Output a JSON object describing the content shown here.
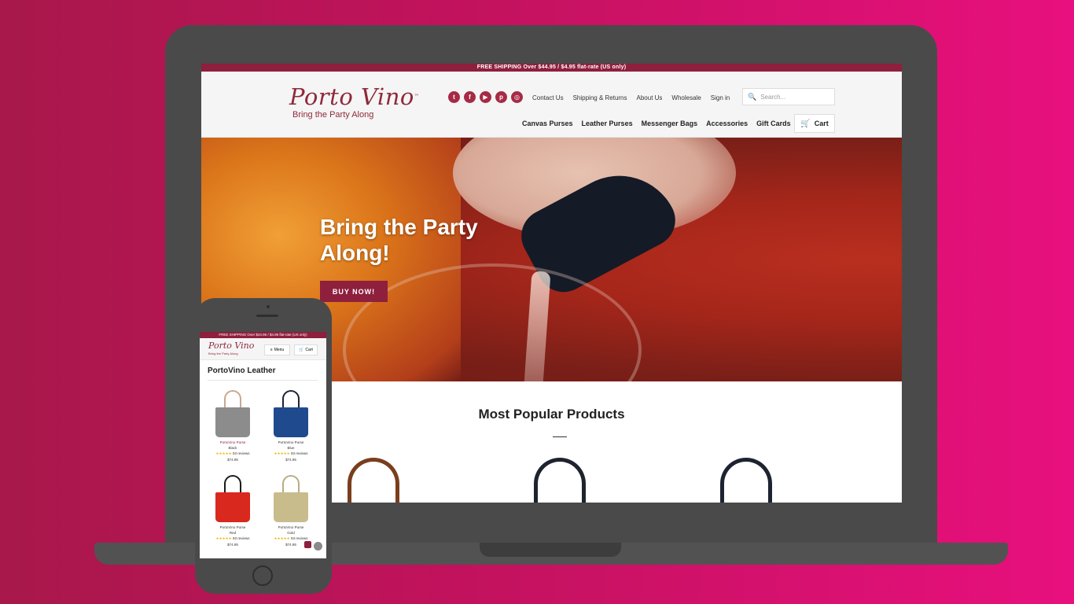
{
  "desktop": {
    "shipping_bar": "FREE SHIPPING Over $44.95 / $4.95 flat-rate (US only)",
    "logo": {
      "name": "Porto Vino",
      "tm": "™",
      "tagline": "Bring the Party Along"
    },
    "socials": [
      {
        "icon": "twitter-icon",
        "glyph": "t"
      },
      {
        "icon": "facebook-icon",
        "glyph": "f"
      },
      {
        "icon": "youtube-icon",
        "glyph": "▶"
      },
      {
        "icon": "pinterest-icon",
        "glyph": "p"
      },
      {
        "icon": "instagram-icon",
        "glyph": "◎"
      }
    ],
    "util_links": [
      "Contact Us",
      "Shipping & Returns",
      "About Us",
      "Wholesale",
      "Sign in"
    ],
    "search": {
      "placeholder": "Search...",
      "icon_glyph": "🔍"
    },
    "nav": [
      "Canvas Purses",
      "Leather Purses",
      "Messenger Bags",
      "Accessories",
      "Gift Cards"
    ],
    "cart": {
      "label": "Cart",
      "icon_glyph": "🛒"
    },
    "hero": {
      "title": "Bring the Party Along!",
      "button": "BUY NOW!"
    },
    "popular": {
      "title": "Most Popular Products"
    }
  },
  "mobile": {
    "shipping_bar": "FREE SHIPPING Over $44.95 / $4.95 flat-rate (US only)",
    "logo": {
      "name": "Porto Vino",
      "tagline": "Bring the Party Along"
    },
    "menu": {
      "label": "Menu",
      "icon_glyph": "≡"
    },
    "cart": {
      "label": "Cart",
      "icon_glyph": "🛒"
    },
    "page_title": "PortoVino Leather",
    "products": [
      {
        "name": "PortoVino Purse",
        "color": "Black",
        "stars": "★★★★★",
        "reviews": "93 reviews",
        "price": "$74.95",
        "bag_color": "#8c8c8c"
      },
      {
        "name": "PortoVino Purse",
        "color": "Blue",
        "stars": "★★★★★",
        "reviews": "93 reviews",
        "price": "$74.95",
        "bag_color": "#1f4a8e"
      },
      {
        "name": "PortoVino Purse",
        "color": "Red",
        "stars": "★★★★★",
        "reviews": "93 reviews",
        "price": "$74.95",
        "bag_color": "#d9281e"
      },
      {
        "name": "PortoVino Purse",
        "color": "Gold",
        "stars": "★★★★★",
        "reviews": "93 reviews",
        "price": "$74.95",
        "bag_color": "#c9bc8c"
      }
    ]
  },
  "colors": {
    "brand": "#8e1f3d",
    "logo": "#8e2a3a",
    "background_left": "#a8184a",
    "background_right": "#e8107e"
  }
}
